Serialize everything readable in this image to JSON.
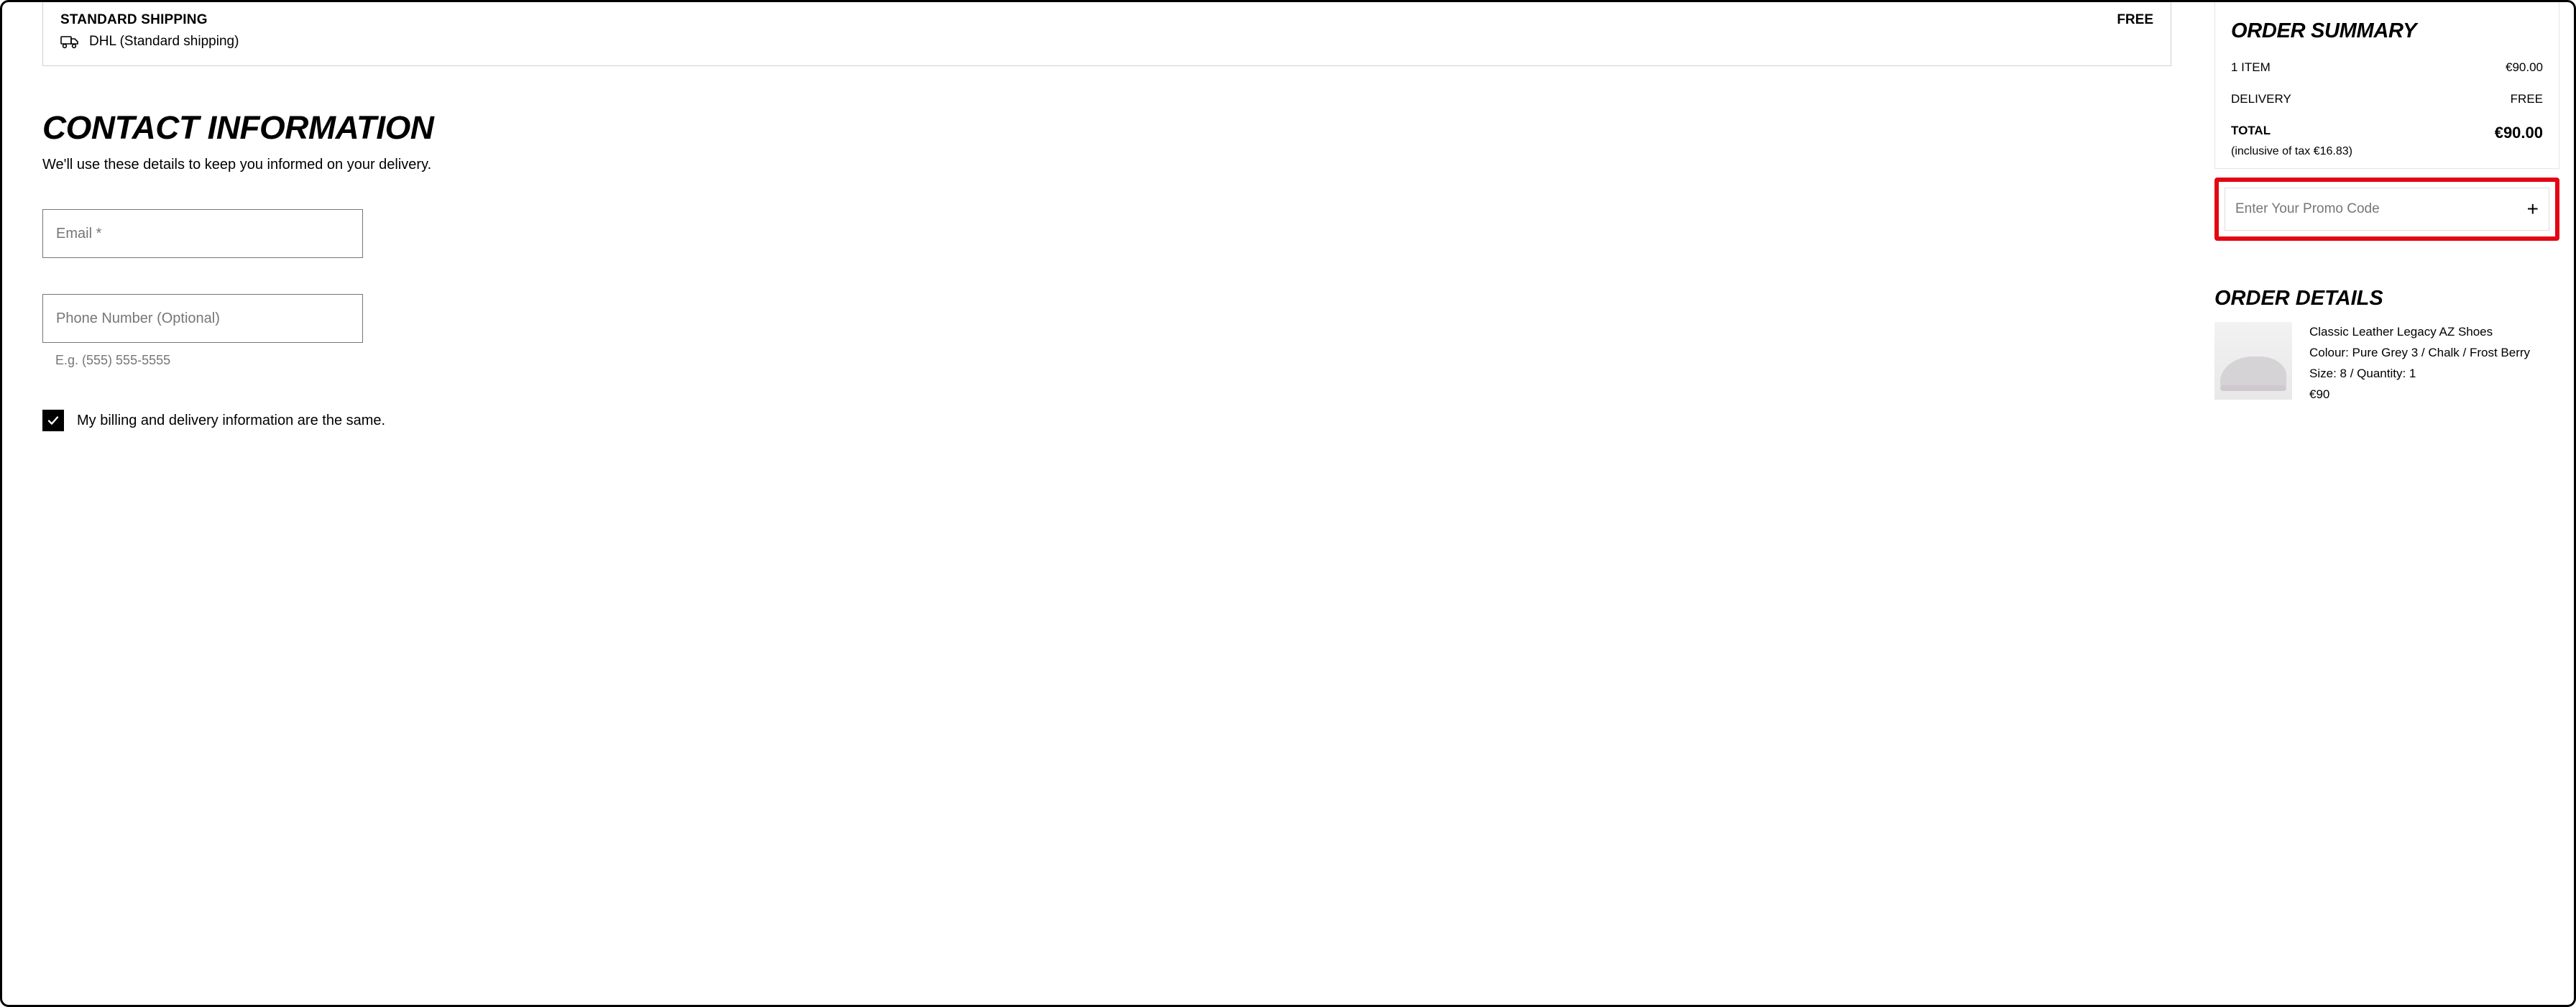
{
  "shipping": {
    "title": "STANDARD SHIPPING",
    "price": "FREE",
    "carrier": "DHL (Standard shipping)"
  },
  "contact": {
    "heading": "CONTACT INFORMATION",
    "sub": "We'll use these details to keep you informed on your delivery.",
    "email_placeholder": "Email *",
    "phone_placeholder": "Phone Number (Optional)",
    "phone_hint": "E.g. (555) 555-5555",
    "same_billing_label": "My billing and delivery information are the same."
  },
  "summary": {
    "title": "ORDER SUMMARY",
    "items_label": "1 ITEM",
    "items_value": "€90.00",
    "delivery_label": "DELIVERY",
    "delivery_value": "FREE",
    "total_label": "TOTAL",
    "total_value": "€90.00",
    "tax_note": "(inclusive of tax  €16.83)"
  },
  "promo": {
    "placeholder": "Enter Your Promo Code"
  },
  "details": {
    "title": "ORDER DETAILS",
    "product_name": "Classic Leather Legacy AZ Shoes",
    "colour_line": "Colour: Pure Grey 3 / Chalk / Frost Berry",
    "size_qty_line": "Size: 8 / Quantity: 1",
    "price": "€90"
  }
}
